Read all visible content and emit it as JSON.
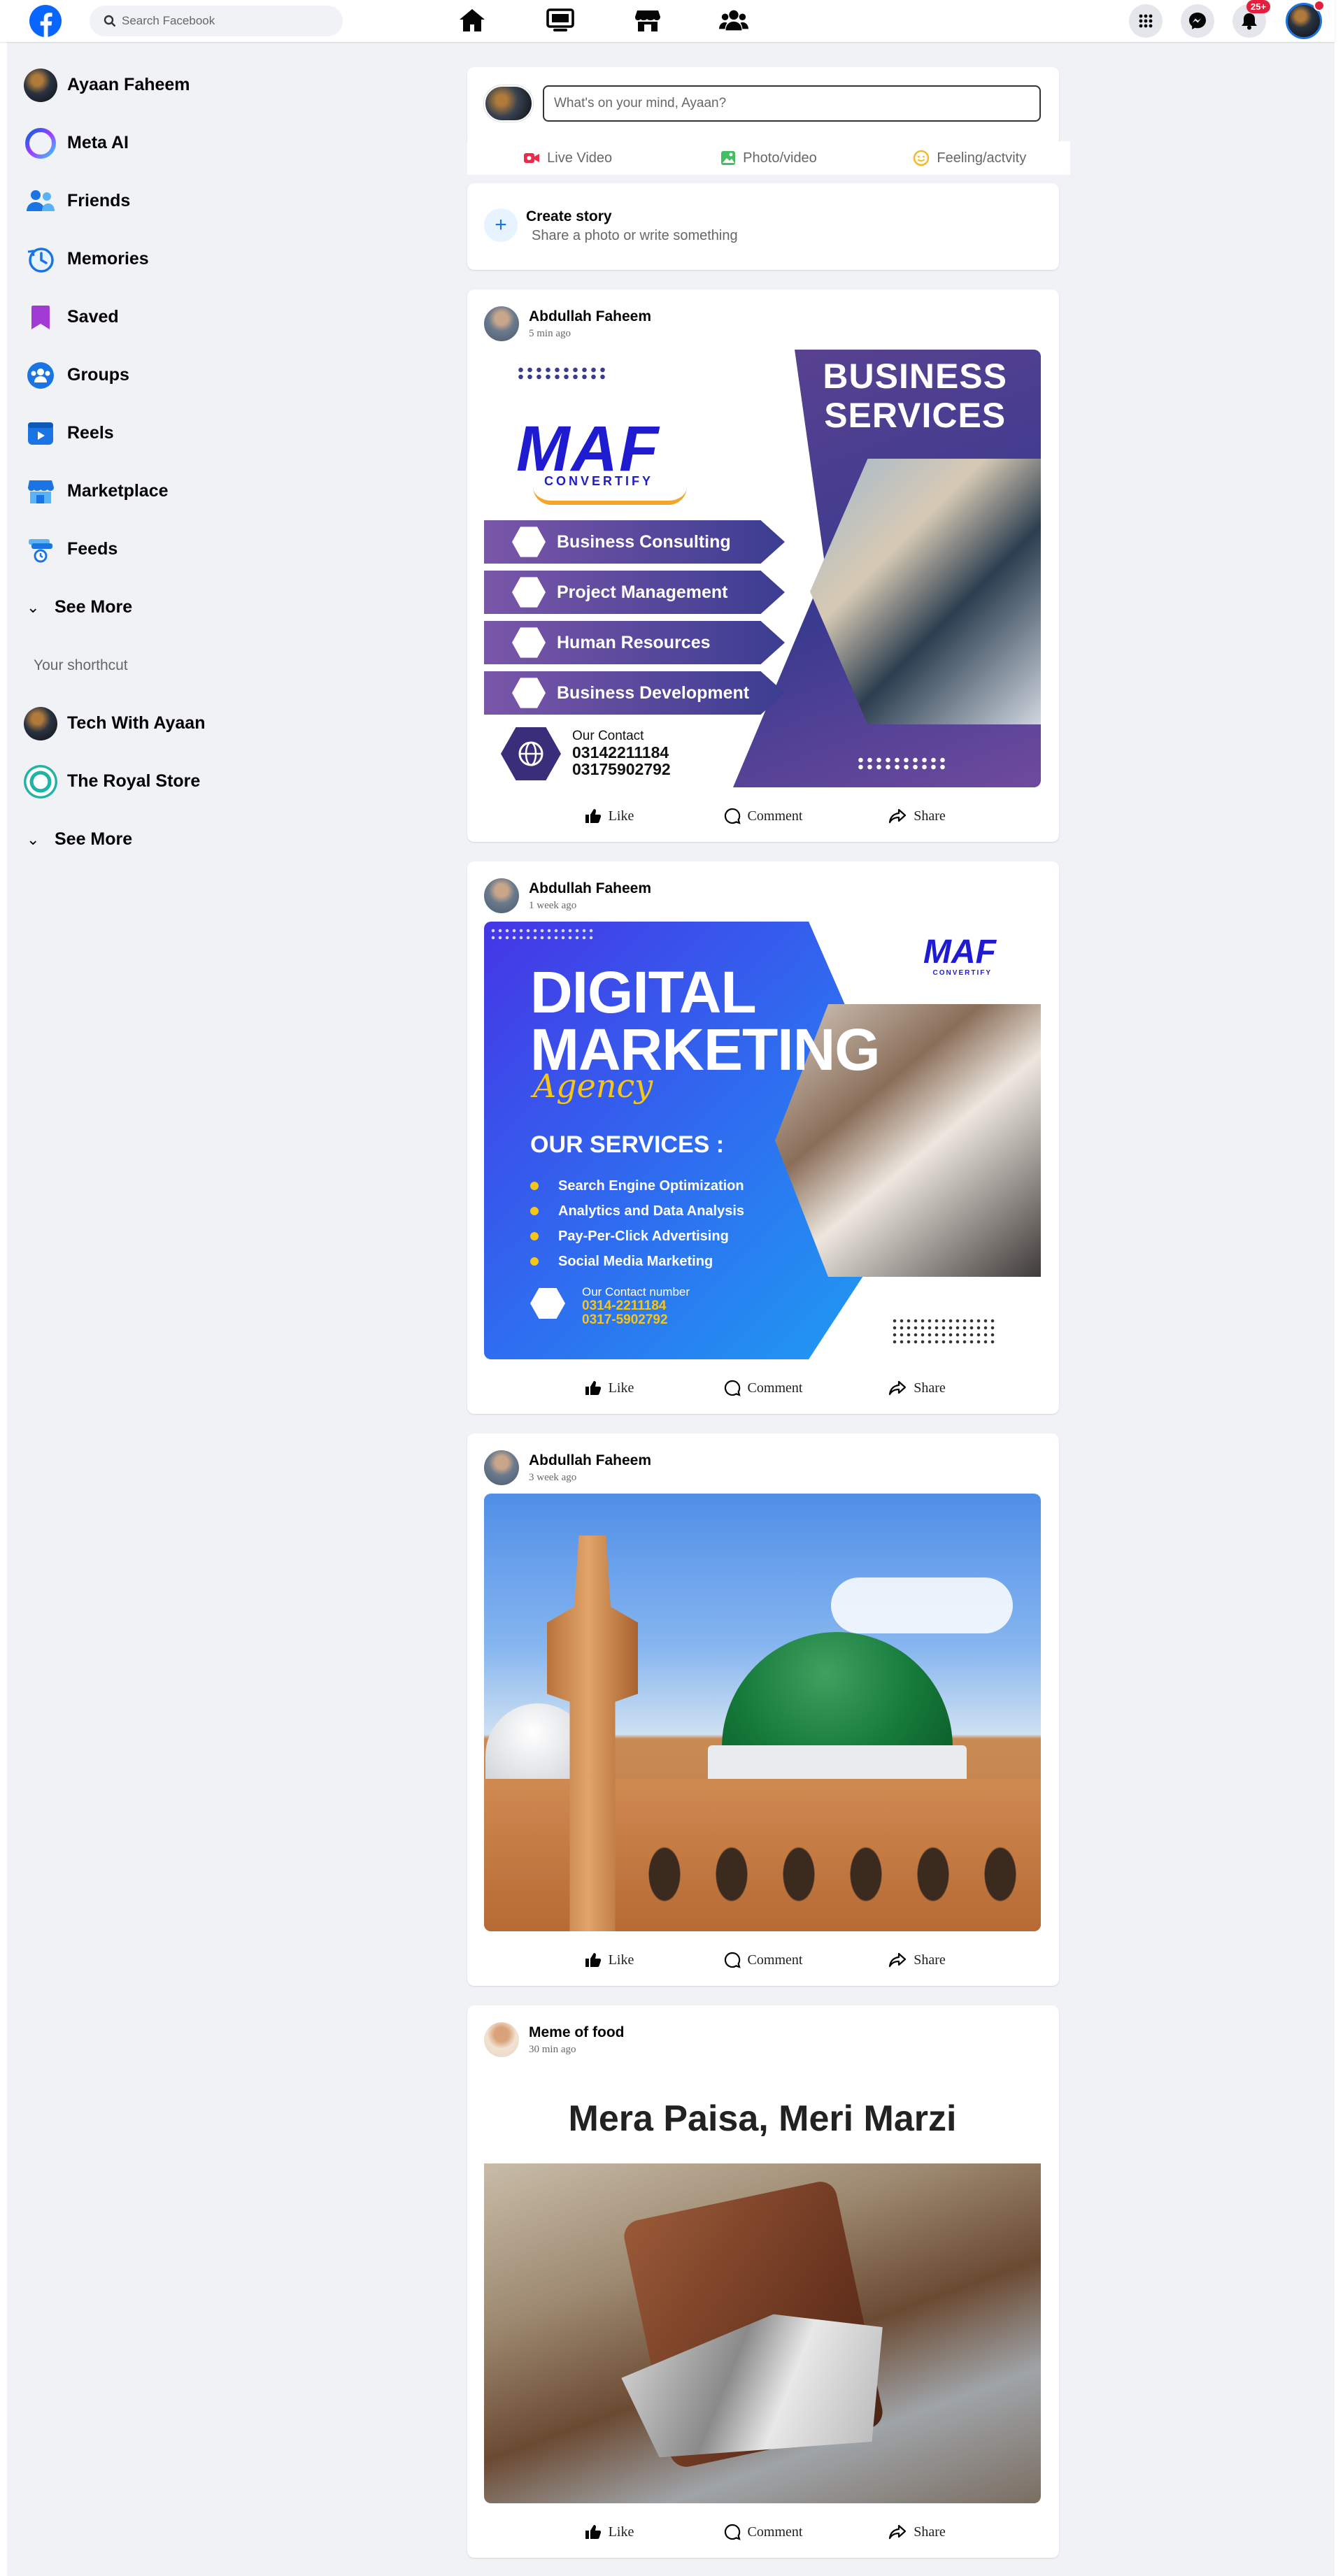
{
  "search": {
    "placeholder": "Search Facebook"
  },
  "topbar": {
    "notifications_badge": "25+"
  },
  "sidebar": {
    "items": [
      {
        "label": "Ayaan Faheem",
        "icon": "profile-avatar"
      },
      {
        "label": "Meta AI",
        "icon": "meta-ai-icon"
      },
      {
        "label": "Friends",
        "icon": "friends-icon"
      },
      {
        "label": "Memories",
        "icon": "memories-icon"
      },
      {
        "label": "Saved",
        "icon": "saved-icon"
      },
      {
        "label": "Groups",
        "icon": "groups-icon"
      },
      {
        "label": "Reels",
        "icon": "reels-icon"
      },
      {
        "label": "Marketplace",
        "icon": "marketplace-icon"
      },
      {
        "label": "Feeds",
        "icon": "feeds-icon"
      }
    ],
    "see_more": "See More",
    "shortcut_heading": "Your shorthcut",
    "shortcuts": [
      {
        "label": "Tech With Ayaan"
      },
      {
        "label": "The Royal Store"
      }
    ],
    "see_more_2": "See More"
  },
  "composer": {
    "placeholder": "What's on your mind, Ayaan?",
    "live": "Live Video",
    "photo": "Photo/video",
    "feeling": "Feeling/actvity"
  },
  "story": {
    "title": "Create story",
    "subtitle": "Share a photo or write something"
  },
  "actions": {
    "like": "Like",
    "comment": "Comment",
    "share": "Share"
  },
  "posts": [
    {
      "author": "Abdullah Faheem",
      "time": "5 min ago",
      "image": {
        "brand": "MAF",
        "brand_sub": "CONVERTIFY",
        "title_line1": "BUSINESS",
        "title_line2": "SERVICES",
        "services": [
          "Business Consulting",
          "Project Management",
          "Human Resources",
          "Business Development"
        ],
        "contact_label": "Our Contact",
        "phone1": "03142211184",
        "phone2": "03175902792"
      }
    },
    {
      "author": "Abdullah Faheem",
      "time": "1 week ago",
      "image": {
        "brand": "MAF",
        "brand_sub": "CONVERTIFY",
        "title_line1": "DIGITAL",
        "title_line2": "MARKETING",
        "agency": "Agency",
        "services_heading": "OUR SERVICES :",
        "services": [
          "Search Engine Optimization",
          "Analytics and Data Analysis",
          "Pay-Per-Click Advertising",
          "Social Media Marketing"
        ],
        "contact_label": "Our Contact number",
        "phone1": "0314-2211184",
        "phone2": "0317-5902792"
      }
    },
    {
      "author": "Abdullah Faheem",
      "time": "3 week ago"
    },
    {
      "author": "Meme of food",
      "time": "30 min ago",
      "image": {
        "caption": "Mera Paisa, Meri Marzi"
      }
    }
  ]
}
